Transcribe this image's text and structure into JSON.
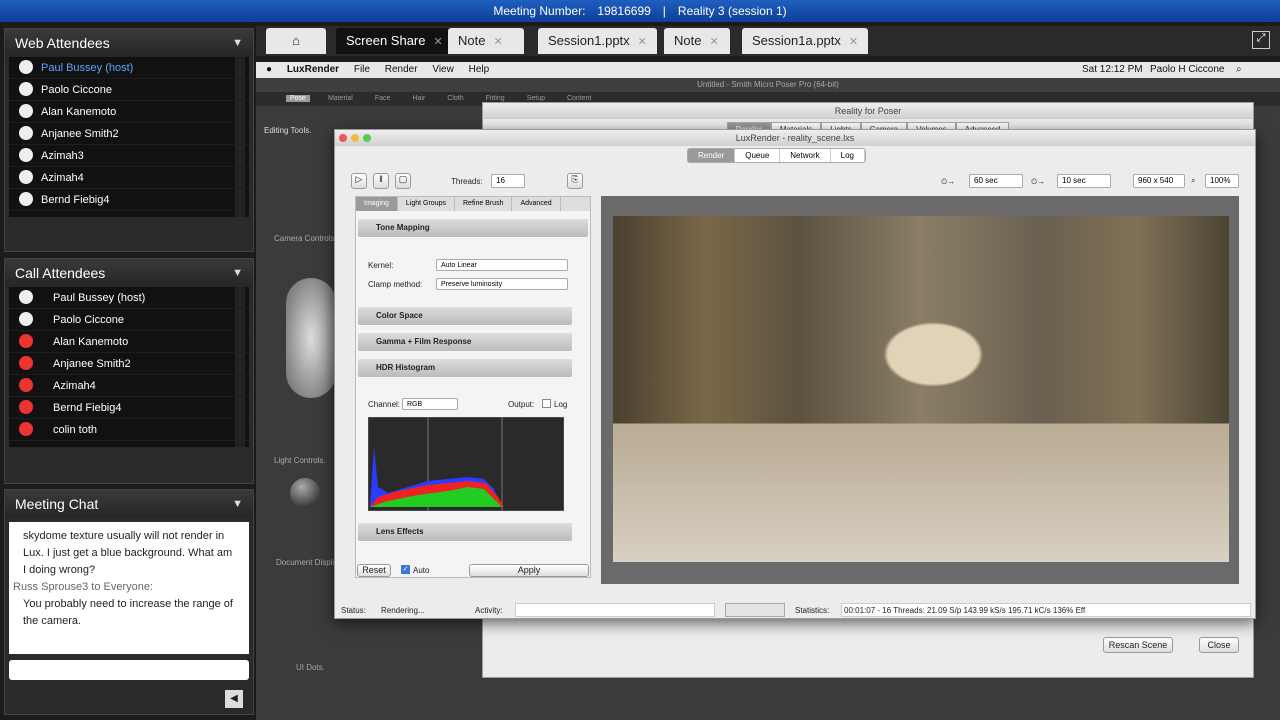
{
  "topbar": {
    "meeting_label": "Meeting Number:",
    "meeting_number": "19816699",
    "separator": "|",
    "session": "Reality 3 (session 1)"
  },
  "web_attendees": {
    "title": "Web Attendees",
    "items": [
      "Paul Bussey (host)",
      "Paolo Ciccone",
      "Alan Kanemoto",
      "Anjanee Smith2",
      "Azimah3",
      "Azimah4",
      "Bernd Fiebig4"
    ]
  },
  "call_attendees": {
    "title": "Call Attendees",
    "items": [
      "Paul Bussey (host)",
      "Paolo Ciccone",
      "Alan Kanemoto",
      "Anjanee Smith2",
      "Azimah4",
      "Bernd Fiebig4",
      "colin toth"
    ]
  },
  "chat": {
    "title": "Meeting Chat",
    "lines": [
      {
        "text": "skydome texture usually will not render in Lux.  I just get a blue background. What am I doing wrong?",
        "from": false
      },
      {
        "text": "Russ Sprouse3 to Everyone:",
        "from": true
      },
      {
        "text": "You probably need to increase the range of the camera.",
        "from": false
      }
    ],
    "input": ""
  },
  "tabs": [
    {
      "label": "Screen Share",
      "active": true
    },
    {
      "label": "Note"
    },
    {
      "label": "Session1.pptx"
    },
    {
      "label": "Note"
    },
    {
      "label": "Session1a.pptx"
    }
  ],
  "mac_menu": {
    "app": "LuxRender",
    "items": [
      "File",
      "Render",
      "View",
      "Help"
    ],
    "clock": "Sat 12:12 PM",
    "user": "Paolo H Ciccone"
  },
  "poser": {
    "title": "Untitled - Smith Micro Poser Pro  (64-bit)",
    "tabs": [
      "Pose",
      "Material",
      "Face",
      "Hair",
      "Cloth",
      "Fitting",
      "Setup",
      "Content"
    ],
    "editing_tools": "Editing Tools.",
    "camera_controls": "Camera Controls",
    "light_controls": "Light Controls.",
    "document_display": "Document Display",
    "ui_dots": "UI Dots."
  },
  "reality": {
    "title": "Reality for Poser",
    "tabs": [
      "Render",
      "Materials",
      "Lights",
      "Camera",
      "Volumes",
      "Advanced"
    ],
    "rescan": "Rescan Scene",
    "close": "Close"
  },
  "lux": {
    "title": "LuxRender - reality_scene.lxs",
    "modes": [
      "Render",
      "Queue",
      "Network",
      "Log"
    ],
    "threads_label": "Threads:",
    "threads": "16",
    "halt_time": "60 sec",
    "refresh": "10 sec",
    "resolution": "960 x 540",
    "zoom": "100%",
    "panel_tabs": [
      "Imaging",
      "Light Groups",
      "Refine Brush",
      "Advanced"
    ],
    "tone_mapping": "Tone Mapping",
    "kernel_label": "Kernel:",
    "kernel": "Auto Linear",
    "clamp_label": "Clamp method:",
    "clamp": "Preserve luminosity",
    "color_space": "Color Space",
    "gamma": "Gamma + Film Response",
    "hdr": "HDR Histogram",
    "channel_label": "Channel:",
    "channel": "RGB",
    "output_label": "Output:",
    "log_label": "Log",
    "lens": "Lens Effects",
    "reset": "Reset",
    "auto": "Auto",
    "apply": "Apply",
    "status_label": "Status:",
    "status": "Rendering...",
    "activity_label": "Activity:",
    "stats_label": "Statistics:",
    "stats": "00:01:07 - 16 Threads: 21.09 S/p 143.99 kS/s 195.71 kC/s 136% Eff"
  }
}
